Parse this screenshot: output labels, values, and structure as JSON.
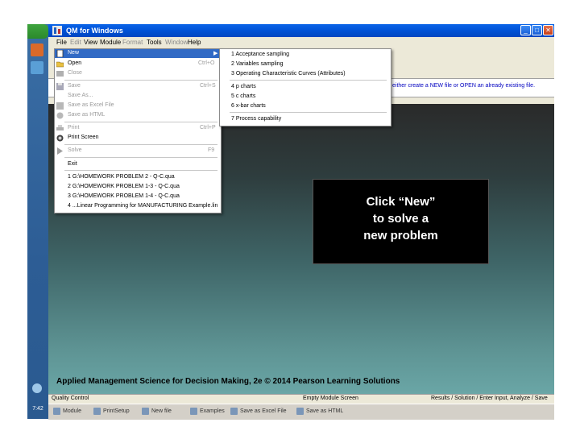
{
  "window": {
    "title": "QM for Windows",
    "menus": [
      "File",
      "Edit",
      "View",
      "Module",
      "Format",
      "Tools",
      "Window",
      "Help"
    ]
  },
  "hint": "either create a NEW file or OPEN an already existing file.",
  "file_menu": {
    "items": [
      {
        "label": "New",
        "shortcut": "",
        "enabled": true,
        "highlighted": true
      },
      {
        "label": "Open",
        "shortcut": "Ctrl+O",
        "enabled": true
      },
      {
        "label": "Close",
        "shortcut": "",
        "enabled": false
      },
      {
        "label": "Save",
        "shortcut": "Ctrl+S",
        "enabled": false
      },
      {
        "label": "Save As...",
        "shortcut": "",
        "enabled": false
      },
      {
        "label": "Save as Excel File",
        "shortcut": "",
        "enabled": false
      },
      {
        "label": "Save as HTML",
        "shortcut": "",
        "enabled": false
      },
      {
        "label": "Print",
        "shortcut": "Ctrl+P",
        "enabled": false
      },
      {
        "label": "Print Screen",
        "shortcut": "",
        "enabled": true
      },
      {
        "label": "Solve",
        "shortcut": "F9",
        "enabled": false
      },
      {
        "label": "Exit",
        "shortcut": "",
        "enabled": true
      }
    ],
    "recent": [
      "1 G:\\HOMEWORK PROBLEM 2 - Q-C.qua",
      "2 G:\\HOMEWORK PROBLEM 1-3 - Q-C.qua",
      "3 G:\\HOMEWORK PROBLEM 1-4 - Q-C.qua",
      "4 ...Linear Programming for MANUFACTURING Example.lin"
    ]
  },
  "new_submenu": {
    "items": [
      "1 Acceptance sampling",
      "2 Variables sampling",
      "3 Operating Characteristic Curves (Attributes)",
      "4 p charts",
      "5 c charts",
      "6 x-bar charts",
      "7 Process capability"
    ]
  },
  "callout": {
    "line1": "Click “New”",
    "line2": "to solve a",
    "line3": "new problem"
  },
  "footer": "Applied Management Science for Decision Making, 2e © 2014 Pearson Learning Solutions",
  "statusbar": {
    "left": "Quality Control",
    "mid": "Empty Module Screen",
    "right": "Results / Solution / Enter Input, Analyze / Save"
  },
  "clock": "7:42 PM",
  "taskbar": [
    "Module",
    "PrintSetup",
    "New file",
    "Examples",
    "Save as Excel File",
    "Save as HTML"
  ],
  "colors": {
    "title_bar": "#0052d6",
    "menu_highlight": "#316ac5",
    "callout_bg": "#000000",
    "callout_text": "#ffffff",
    "hint_text": "#0000c0"
  }
}
